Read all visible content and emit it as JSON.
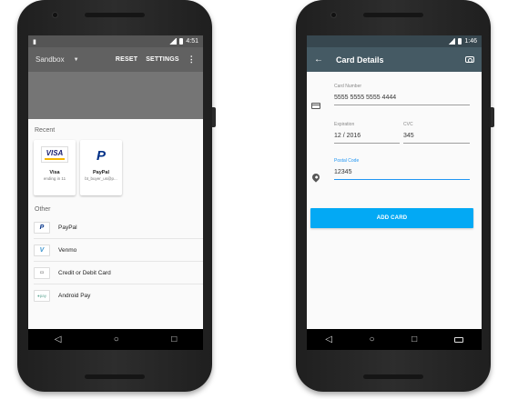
{
  "left_phone": {
    "status": {
      "time": "4:51"
    },
    "toolbar": {
      "title": "Sandbox",
      "reset_label": "RESET",
      "settings_label": "SETTINGS"
    },
    "recent": {
      "heading": "Recent",
      "cards": [
        {
          "name": "Visa",
          "detail": "ending in 11",
          "icon": "visa-icon"
        },
        {
          "name": "PayPal",
          "detail": "bt_buyer_us@p...",
          "icon": "paypal-icon"
        }
      ]
    },
    "other": {
      "heading": "Other",
      "items": [
        {
          "label": "PayPal",
          "icon": "paypal-icon"
        },
        {
          "label": "Venmo",
          "icon": "venmo-icon"
        },
        {
          "label": "Credit or Debit Card",
          "icon": "credit-card-icon"
        },
        {
          "label": "Android Pay",
          "icon": "android-pay-icon"
        }
      ]
    }
  },
  "right_phone": {
    "status": {
      "time": "1:46"
    },
    "toolbar": {
      "title": "Card Details"
    },
    "form": {
      "card_number": {
        "label": "Card Number",
        "value": "5555 5555 5555 4444"
      },
      "expiration": {
        "label": "Expiration",
        "value": "12 / 2016"
      },
      "cvc": {
        "label": "CVC",
        "value": "345"
      },
      "postal_code": {
        "label": "Postal Code",
        "value": "12345"
      },
      "submit_label": "ADD CARD"
    }
  },
  "colors": {
    "left_toolbar": "#616161",
    "right_toolbar": "#455a64",
    "accent": "#03a9f4",
    "focus": "#2196f3"
  }
}
